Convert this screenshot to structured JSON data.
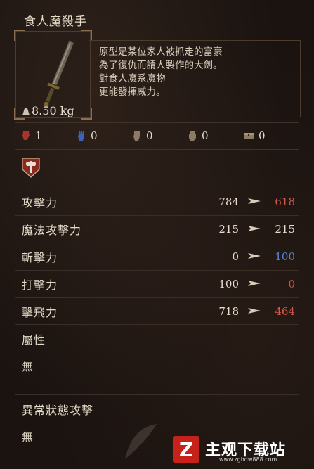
{
  "item": {
    "name": "食人魔殺手",
    "weight": "8.50 kg",
    "description": [
      "原型是某位家人被抓走的富豪",
      "為了復仇而請人製作的大劍。",
      "對食人魔系魔物",
      "更能發揮威力。"
    ]
  },
  "equip_stats": [
    {
      "icon": "strength-icon",
      "value": "1"
    },
    {
      "icon": "magic-hand-icon",
      "value": "0"
    },
    {
      "icon": "dexterity-hand-icon",
      "value": "0"
    },
    {
      "icon": "fist-icon",
      "value": "0"
    },
    {
      "icon": "chest-icon",
      "value": "0"
    }
  ],
  "weapon_class_icon": "axe-shield-emblem-icon",
  "attack_stats": [
    {
      "label": "攻擊力",
      "current": "784",
      "new": "618",
      "new_color": "#d0584a"
    },
    {
      "label": "魔法攻擊力",
      "current": "215",
      "new": "215",
      "new_color": "#e6dccb"
    },
    {
      "label": "斬擊力",
      "current": "0",
      "new": "100",
      "new_color": "#5a86d6"
    },
    {
      "label": "打擊力",
      "current": "100",
      "new": "0",
      "new_color": "#d0584a"
    },
    {
      "label": "擊飛力",
      "current": "718",
      "new": "464",
      "new_color": "#d0584a"
    }
  ],
  "attribute": {
    "label": "屬性",
    "value": "無"
  },
  "status_effect": {
    "label": "異常狀態攻擊",
    "value": "無"
  },
  "watermark": {
    "logo_letter": "Z",
    "text": "主观下载站",
    "url": "www.zghdw888.com"
  }
}
